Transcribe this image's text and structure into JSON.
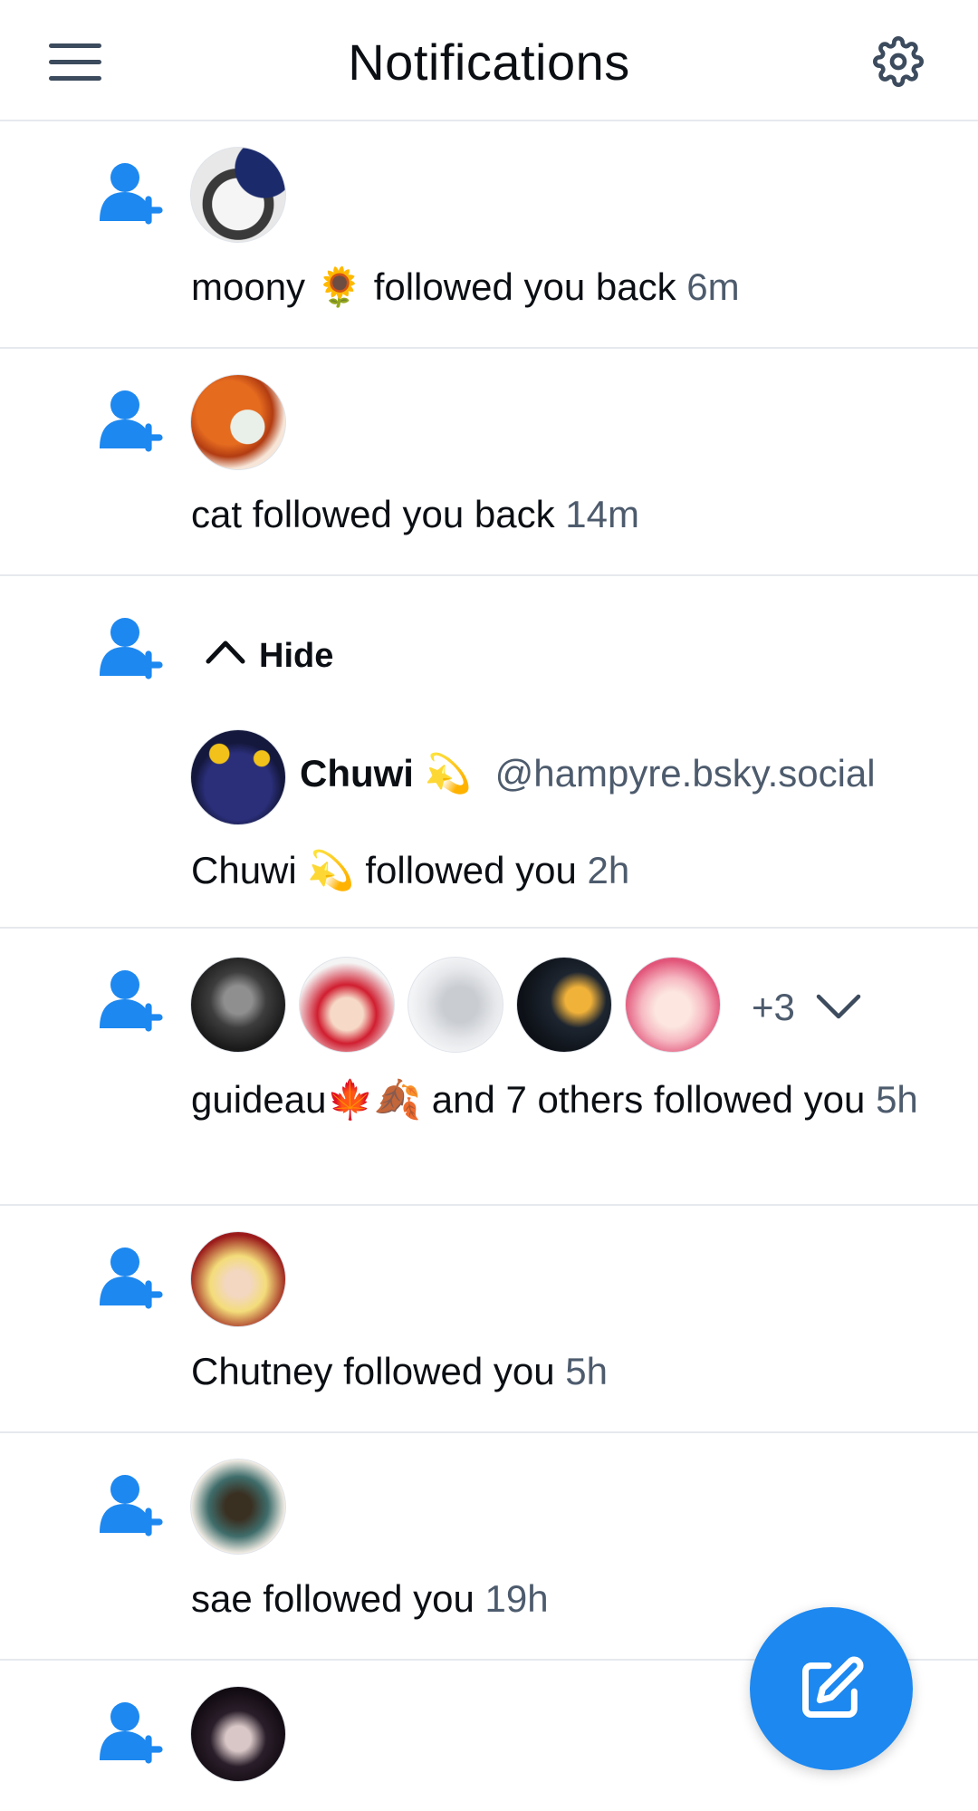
{
  "header": {
    "title": "Notifications",
    "menu_icon": "hamburger-menu-icon",
    "settings_icon": "gear-icon"
  },
  "colors": {
    "accent": "#1d88f0",
    "text_primary": "#0b0f14",
    "text_secondary": "#4d5b6d",
    "divider": "#e6e9ee"
  },
  "notifications": [
    {
      "type": "follow",
      "name": "moony",
      "emoji": "🌻",
      "text": "followed you back",
      "time": "6m"
    },
    {
      "type": "follow",
      "name": "cat",
      "text": "followed you back",
      "time": "14m"
    },
    {
      "type": "follow",
      "expanded": true,
      "hide_label": "Hide",
      "profile": {
        "name": "Chuwi",
        "emoji": "💫",
        "handle": "@hampyre.bsky.social"
      },
      "name": "Chuwi",
      "emoji": "💫",
      "text": "followed you",
      "time": "2h"
    },
    {
      "type": "follow-group",
      "name": "guideau",
      "emoji": "🍁🍂",
      "text": "and 7 others followed you",
      "time": "5h",
      "more_count": "+3"
    },
    {
      "type": "follow",
      "name": "Chutney",
      "text": "followed you",
      "time": "5h"
    },
    {
      "type": "follow",
      "name": "sae",
      "text": "followed you",
      "time": "19h"
    },
    {
      "type": "follow"
    }
  ],
  "fab": {
    "icon": "compose-icon",
    "label": ""
  }
}
